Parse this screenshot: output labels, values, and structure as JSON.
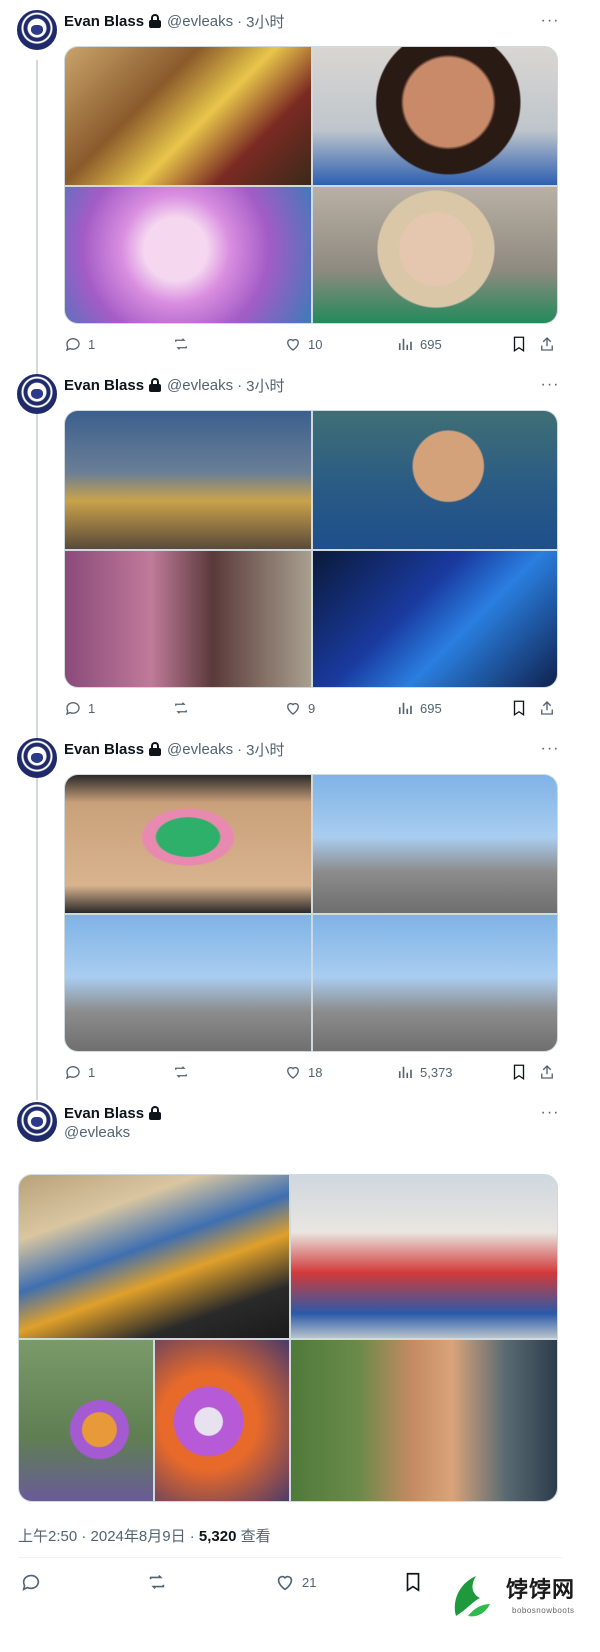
{
  "tweets": [
    {
      "author": "Evan Blass",
      "handle": "@evleaks",
      "dot": "·",
      "time": "3小时",
      "more": "···",
      "photos": [
        "photo-couple-sitting",
        "photo-woman-portrait",
        "photo-flower-macro",
        "photo-woman-sunglasses"
      ],
      "replies": "1",
      "reposts": "",
      "likes": "10",
      "views": "695"
    },
    {
      "author": "Evan Blass",
      "handle": "@evleaks",
      "dot": "·",
      "time": "3小时",
      "more": "···",
      "photos": [
        "photo-couple-street",
        "photo-woman-smiling",
        "photo-friends-collage",
        "photo-man-car-neon"
      ],
      "replies": "1",
      "reposts": "",
      "likes": "9",
      "views": "695"
    },
    {
      "author": "Evan Blass",
      "handle": "@evleaks",
      "dot": "·",
      "time": "3小时",
      "more": "···",
      "photos": [
        "photo-paper-squirrel",
        "photo-group-wall-1",
        "photo-group-wall-2",
        "photo-group-wall-3"
      ],
      "replies": "1",
      "reposts": "",
      "likes": "18",
      "views": "5,373"
    }
  ],
  "main_tweet": {
    "author": "Evan Blass",
    "handle": "@evleaks",
    "more": "···",
    "photos": [
      "photo-group-bench",
      "photo-friends-jersey",
      "photo-woman-bouquet",
      "photo-flowers-closeup",
      "photo-friends-hug"
    ],
    "timestamp": "上午2:50 · 2024年8月9日 · ",
    "views_count": "5,320",
    "views_label": " 查看",
    "replies": "",
    "reposts": "",
    "likes": "21"
  },
  "watermark": {
    "text": "饽饽网",
    "sub": "bobosnowboots"
  },
  "colors": {
    "text": "#0f1419",
    "secondary": "#536471",
    "border": "#cfd9de",
    "thread": "#cfd9de"
  }
}
